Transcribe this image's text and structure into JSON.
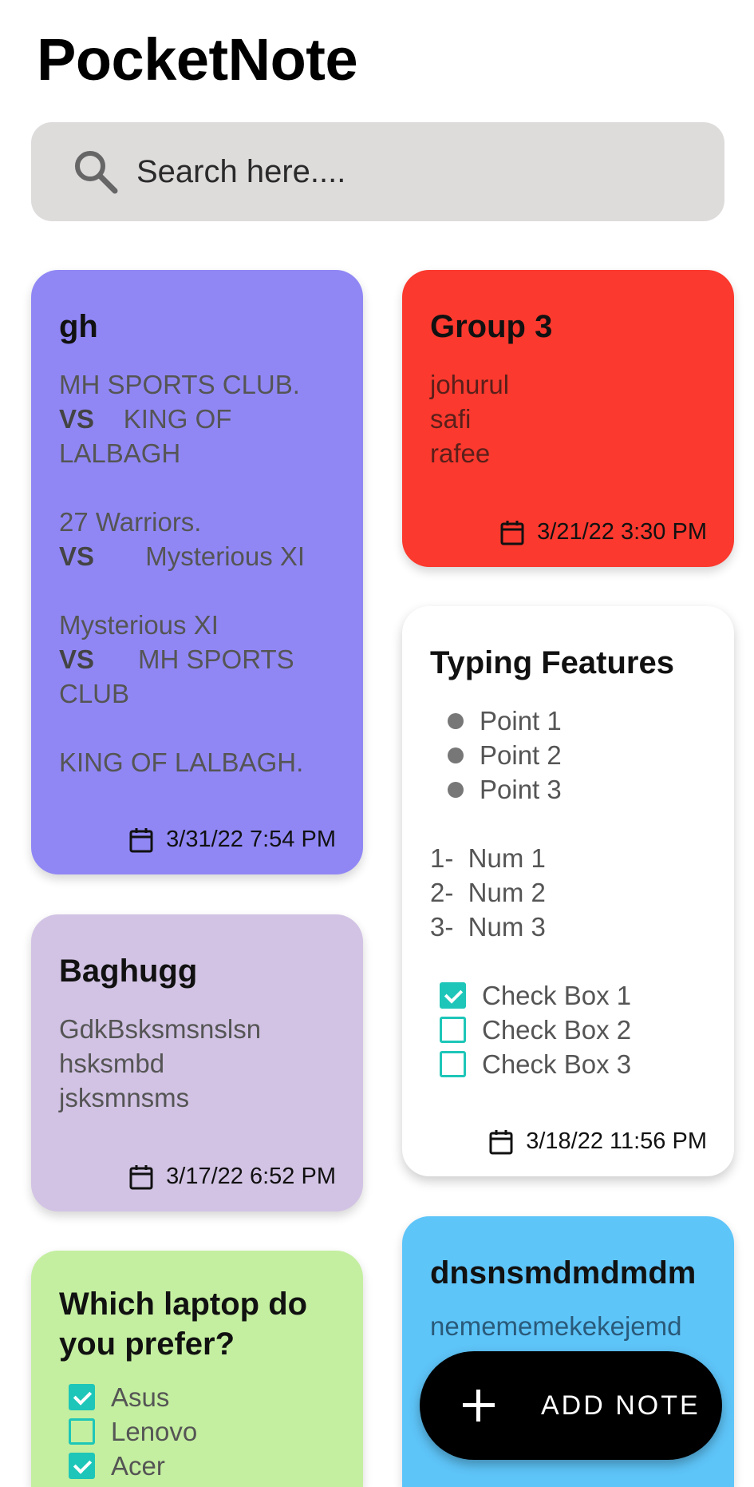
{
  "app_title": "PocketNote",
  "search": {
    "placeholder": "Search here...."
  },
  "colors": {
    "purple": "#9087f5",
    "red": "#fb392e",
    "white": "#ffffff",
    "lavender": "#d2c3e4",
    "green": "#c4efa0",
    "blue": "#5ec5f9",
    "accent": "#1dc6b8"
  },
  "notes": {
    "gh": {
      "title": "gh",
      "lines": [
        "MH SPORTS CLUB.",
        "VS",
        "KING OF",
        "LALBAGH",
        "27 Warriors.",
        "VS",
        "Mysterious XI",
        "Mysterious XI",
        "VS",
        "MH SPORTS",
        "CLUB",
        "KING OF LALBAGH."
      ],
      "date": "3/31/22 7:54 PM"
    },
    "group3": {
      "title": "Group 3",
      "lines": [
        "johurul",
        "safi",
        "rafee"
      ],
      "date": "3/21/22 3:30 PM"
    },
    "typing": {
      "title": "Typing Features",
      "bullets": [
        "Point 1",
        "Point 2",
        "Point 3"
      ],
      "numbered": [
        "1-  Num 1",
        "2-  Num 2",
        "3-  Num 3"
      ],
      "checks": [
        {
          "label": "Check Box 1",
          "checked": true
        },
        {
          "label": "Check Box 2",
          "checked": false
        },
        {
          "label": "Check Box 3",
          "checked": false
        }
      ],
      "date": "3/18/22 11:56 PM"
    },
    "baghugg": {
      "title": "Baghugg",
      "lines": [
        "GdkBsksmsnslsn",
        "hsksmbd",
        "jsksmnsms"
      ],
      "date": "3/17/22 6:52 PM"
    },
    "laptop": {
      "title_line1": "Which laptop do",
      "title_line2": "you prefer?",
      "checks": [
        {
          "label": "Asus",
          "checked": true
        },
        {
          "label": "Lenovo",
          "checked": false
        },
        {
          "label": "Acer",
          "checked": true
        }
      ]
    },
    "dns": {
      "title": "dnsnsmdmdmdm",
      "lines": [
        "nemememekekejemd"
      ]
    }
  },
  "fab": {
    "label": "ADD NOTE",
    "icon": "plus-icon"
  }
}
